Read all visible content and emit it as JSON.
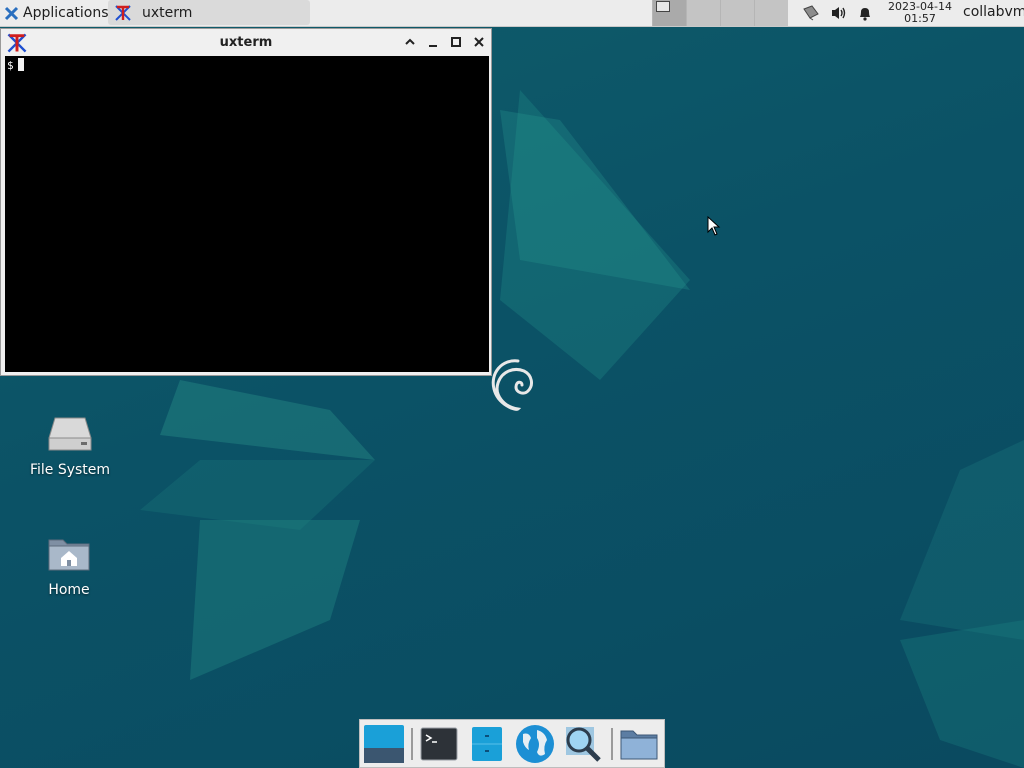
{
  "panel": {
    "apps_label": "Applications",
    "task_title": "uxterm",
    "clock_date": "2023-04-14",
    "clock_time": "01:57",
    "user": "collabvm"
  },
  "window": {
    "title": "uxterm",
    "prompt": "$"
  },
  "desktop": {
    "icons": [
      {
        "label": "File System",
        "icon": "drive-icon"
      },
      {
        "label": "Home",
        "icon": "home-folder-icon"
      }
    ]
  },
  "dock": {
    "items": [
      {
        "name": "show-desktop",
        "icon": "desktop-icon"
      },
      {
        "name": "terminal",
        "icon": "terminal-icon"
      },
      {
        "name": "file-manager",
        "icon": "file-cabinet-icon"
      },
      {
        "name": "web-browser",
        "icon": "globe-icon"
      },
      {
        "name": "app-finder",
        "icon": "magnifier-icon"
      },
      {
        "name": "folder",
        "icon": "folder-icon"
      }
    ]
  },
  "colors": {
    "desktop_bg": "#0b5266",
    "panel_bg": "#ececec",
    "terminal_bg": "#000000",
    "accent": "#1aa0d8"
  }
}
